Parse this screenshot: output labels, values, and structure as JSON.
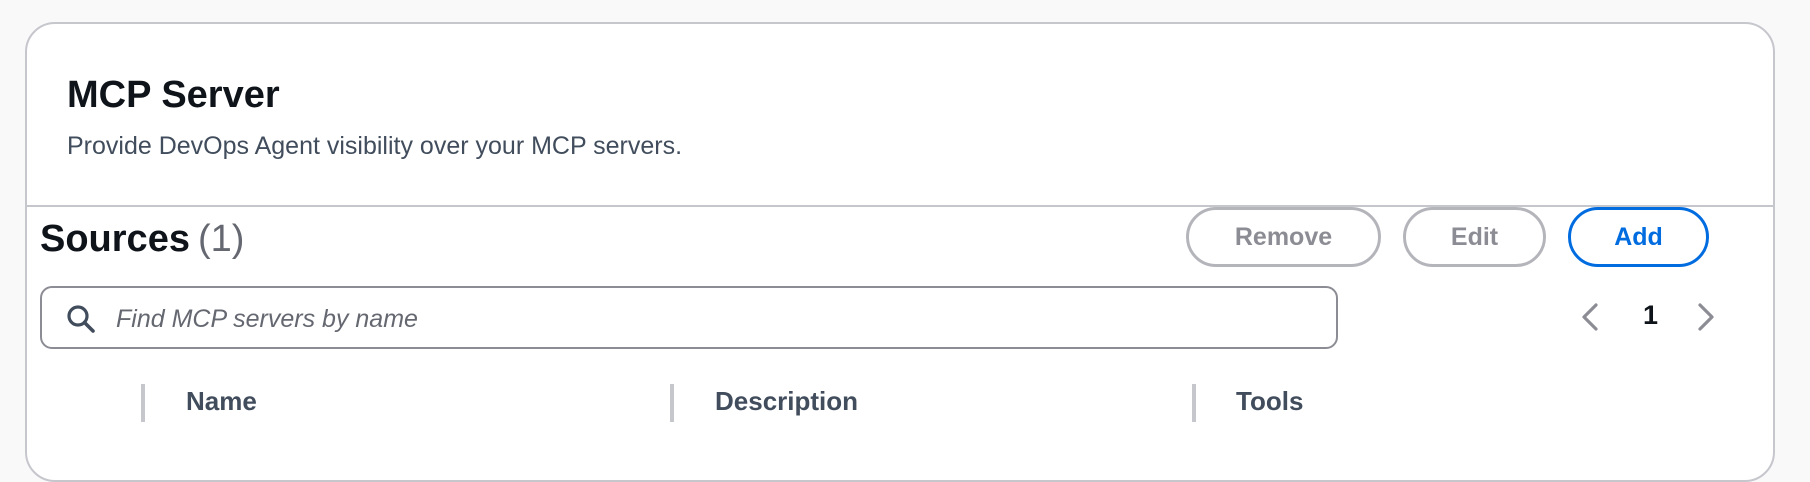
{
  "panel": {
    "title": "MCP Server",
    "description": "Provide DevOps Agent visibility over your MCP servers."
  },
  "sources": {
    "heading": "Sources",
    "count": "(1)"
  },
  "actions": {
    "remove_label": "Remove",
    "edit_label": "Edit",
    "add_label": "Add"
  },
  "search": {
    "placeholder": "Find MCP servers by name",
    "value": ""
  },
  "pagination": {
    "current_page": "1"
  },
  "table": {
    "columns": [
      "Name",
      "Description",
      "Tools"
    ]
  },
  "icons": {
    "search": "search-icon",
    "prev": "chevron-left-icon",
    "next": "chevron-right-icon"
  },
  "colors": {
    "primary": "#006ce0",
    "disabled_border": "#b4b4bb",
    "disabled_text": "#8c8c94",
    "border": "#c6c6cd"
  }
}
